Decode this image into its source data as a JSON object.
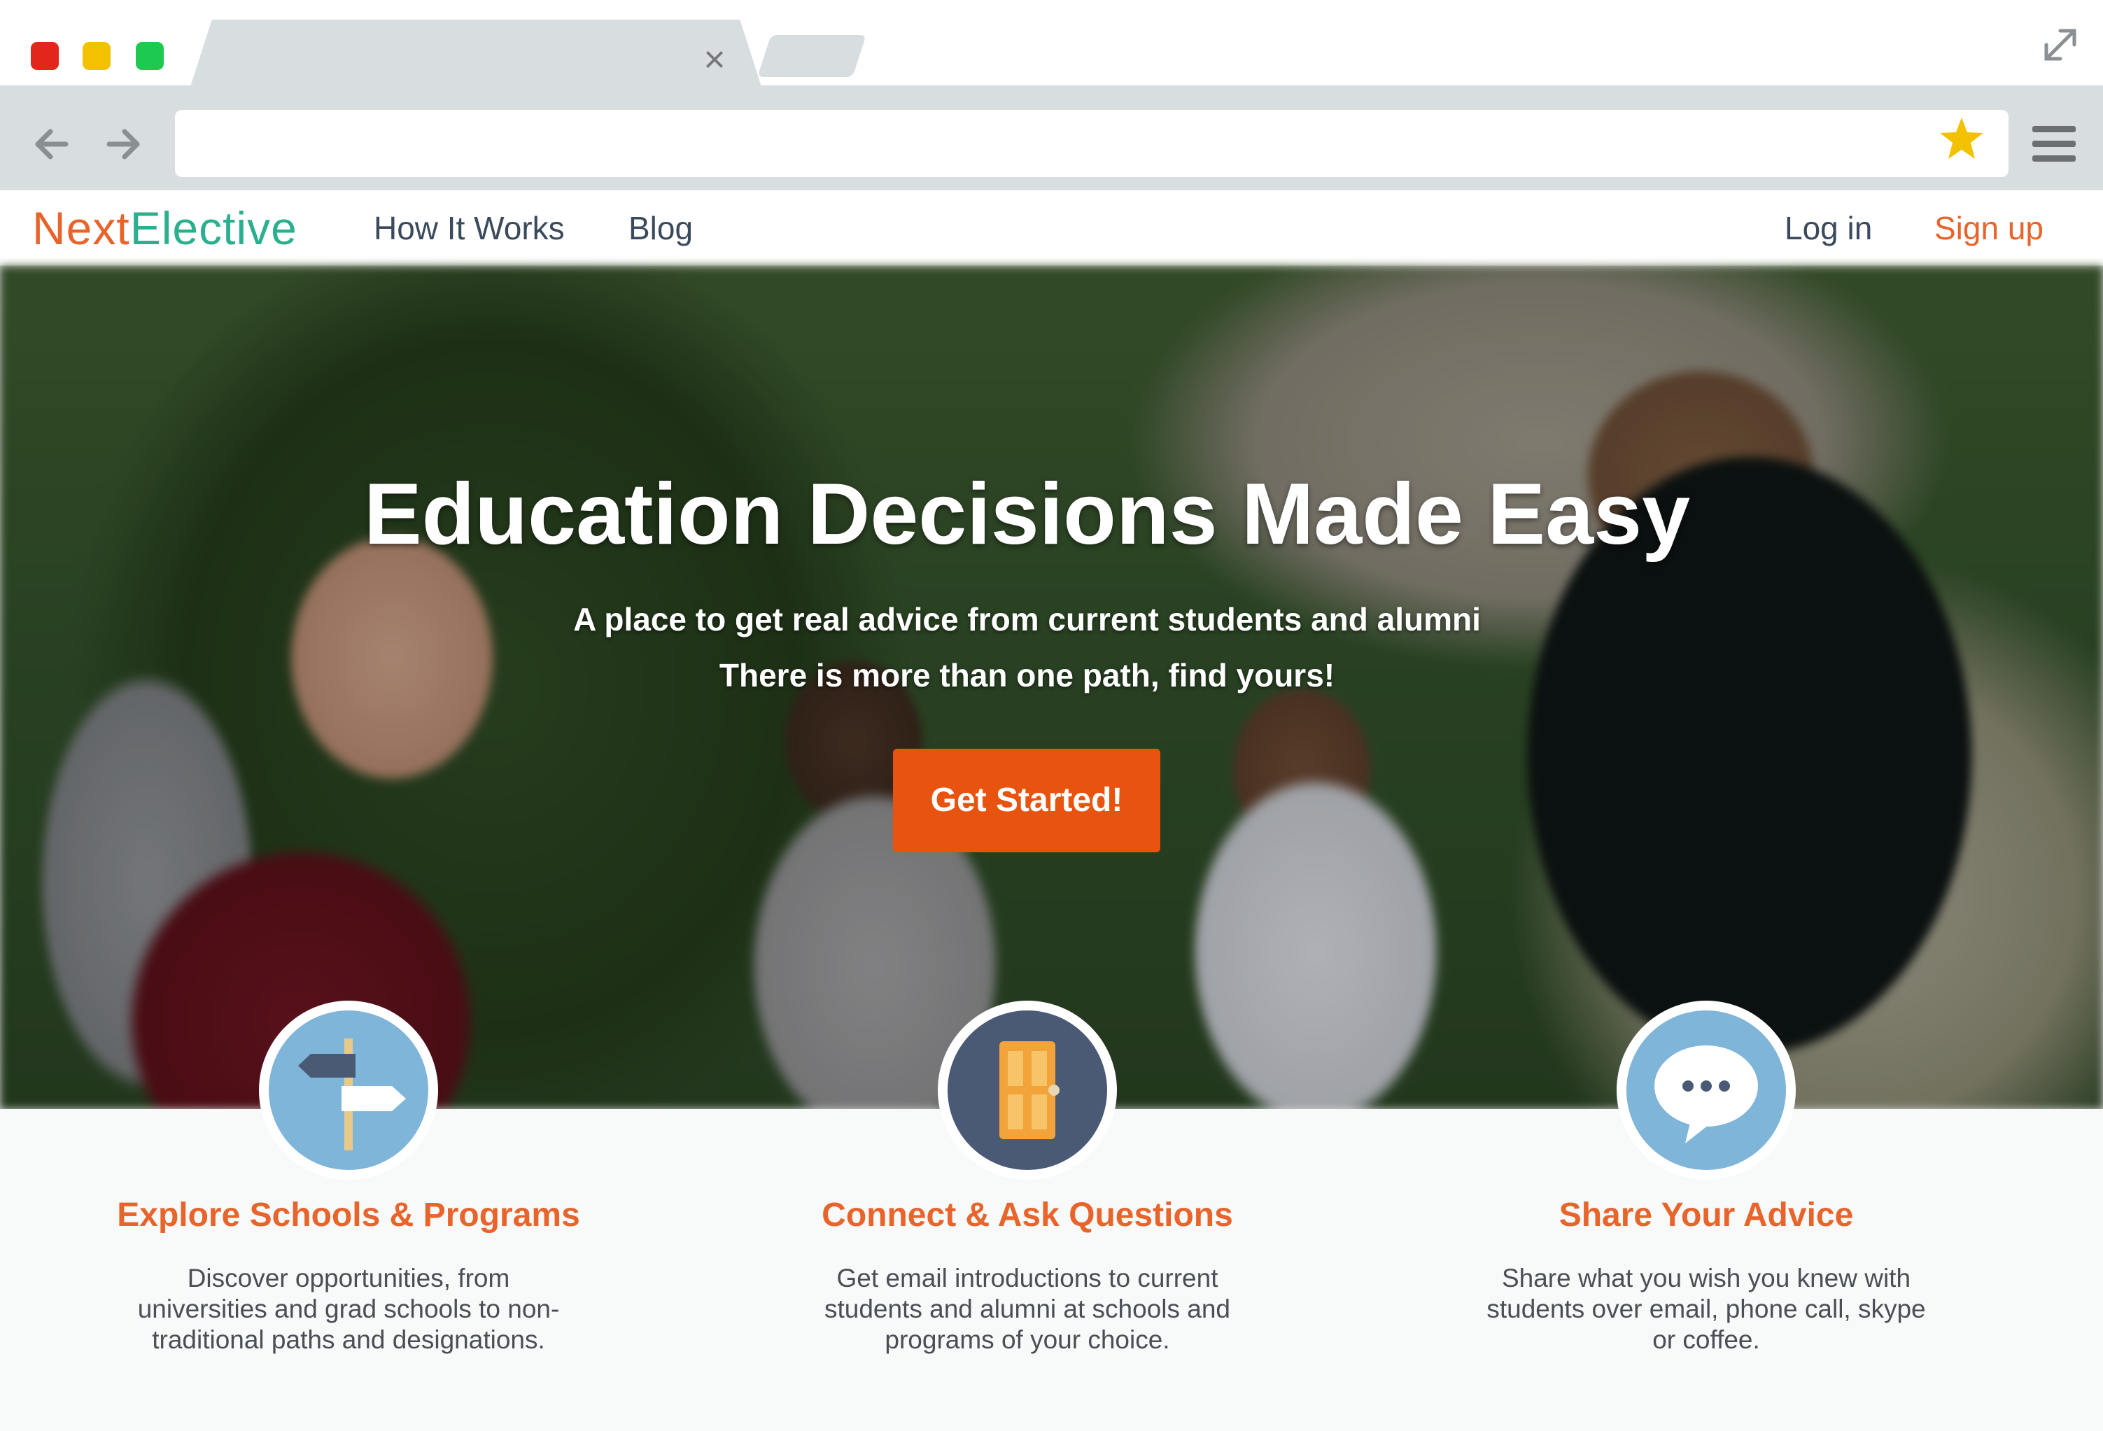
{
  "browser": {
    "window_controls": [
      "close",
      "minimize",
      "maximize"
    ],
    "tab": {
      "close_icon": "×"
    },
    "toolbar": {
      "back_icon": "back-arrow-icon",
      "forward_icon": "forward-arrow-icon",
      "address": "",
      "bookmark_icon": "star-icon",
      "menu_icon": "hamburger-menu-icon"
    },
    "accent_star": "#f2c200"
  },
  "site": {
    "logo_part1": "Next",
    "logo_part2": "Elective",
    "nav": {
      "how_it_works": "How It Works",
      "blog": "Blog",
      "login": "Log in",
      "signup": "Sign up"
    },
    "brand_orange": "#e8642b",
    "brand_teal": "#2bb08f"
  },
  "hero": {
    "title": "Education Decisions Made Easy",
    "subtitle_line1": "A place to get real advice from current students and alumni",
    "subtitle_line2": "There is more than one path, find yours!",
    "cta": "Get Started!",
    "cta_color": "#e8530f"
  },
  "features": [
    {
      "icon": "signpost-icon",
      "title": "Explore Schools & Programs",
      "description": "Discover opportunities, from universities and grad schools to non-traditional paths and designations."
    },
    {
      "icon": "door-icon",
      "title": "Connect & Ask Questions",
      "description": "Get email introductions to current students and alumni at schools and programs of your choice."
    },
    {
      "icon": "speech-bubble-icon",
      "title": "Share Your Advice",
      "description": "Share what you wish you knew with students over email, phone call, skype or coffee."
    }
  ]
}
